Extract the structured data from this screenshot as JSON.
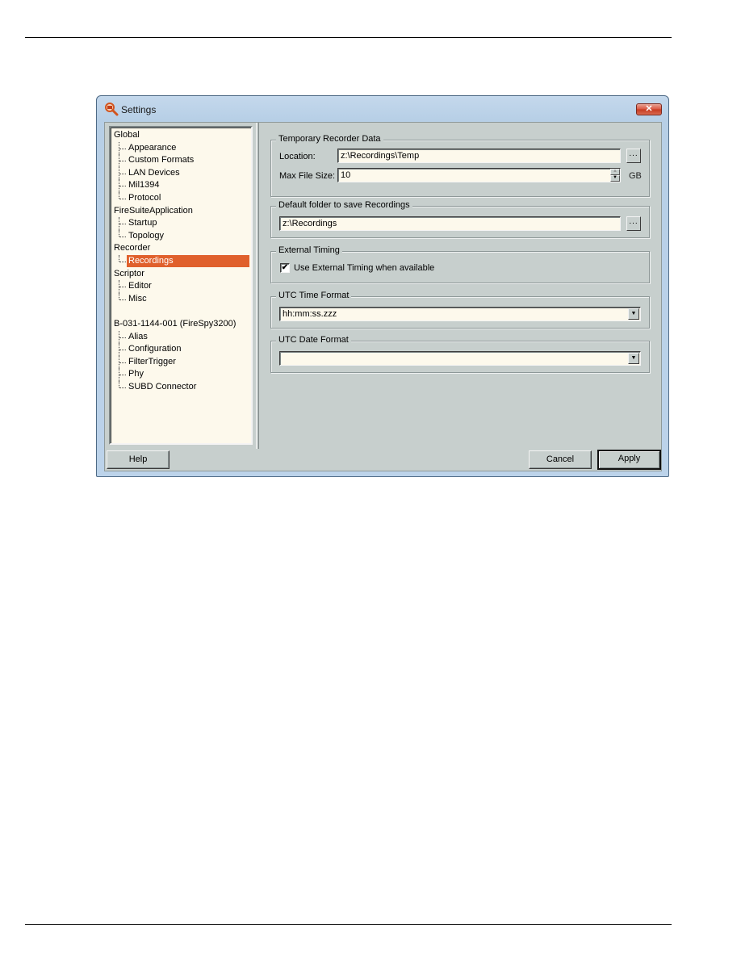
{
  "window": {
    "title": "Settings",
    "app_icon": "magnifier-icon",
    "close_label": "✕"
  },
  "tree": {
    "items": [
      {
        "label": "Global",
        "level": 0
      },
      {
        "label": "Appearance",
        "level": 1
      },
      {
        "label": "Custom Formats",
        "level": 1
      },
      {
        "label": "LAN Devices",
        "level": 1
      },
      {
        "label": "Mil1394",
        "level": 1
      },
      {
        "label": "Protocol",
        "level": 1
      },
      {
        "label": "FireSuiteApplication",
        "level": 0
      },
      {
        "label": "Startup",
        "level": 1
      },
      {
        "label": "Topology",
        "level": 1
      },
      {
        "label": "Recorder",
        "level": 0
      },
      {
        "label": "Recordings",
        "level": 1,
        "selected": true
      },
      {
        "label": "Scriptor",
        "level": 0
      },
      {
        "label": "Editor",
        "level": 1
      },
      {
        "label": "Misc",
        "level": 1
      },
      {
        "label": "B-031-1144-001 (FireSpy3200)",
        "level": 0
      },
      {
        "label": "Alias",
        "level": 1
      },
      {
        "label": "Configuration",
        "level": 1
      },
      {
        "label": "FilterTrigger",
        "level": 1
      },
      {
        "label": "Phy",
        "level": 1
      },
      {
        "label": "SUBD Connector",
        "level": 1
      }
    ]
  },
  "temp_recorder": {
    "legend": "Temporary Recorder Data",
    "location_label": "Location:",
    "location_value": "z:\\Recordings\\Temp",
    "max_size_label": "Max File Size:",
    "max_size_value": "10",
    "max_size_unit": "GB",
    "browse_label": "..."
  },
  "default_folder": {
    "legend": "Default folder to save Recordings",
    "value": "z:\\Recordings",
    "browse_label": "..."
  },
  "external_timing": {
    "legend": "External Timing",
    "checkbox_label": "Use External Timing when available",
    "checked": true,
    "check_glyph": "✔"
  },
  "utc_time": {
    "legend": "UTC Time Format",
    "value": "hh:mm:ss.zzz"
  },
  "utc_date": {
    "legend": "UTC Date Format",
    "value": ""
  },
  "dropdown_glyph": "▼",
  "buttons": {
    "help": "Help",
    "cancel": "Cancel",
    "apply": "Apply"
  }
}
